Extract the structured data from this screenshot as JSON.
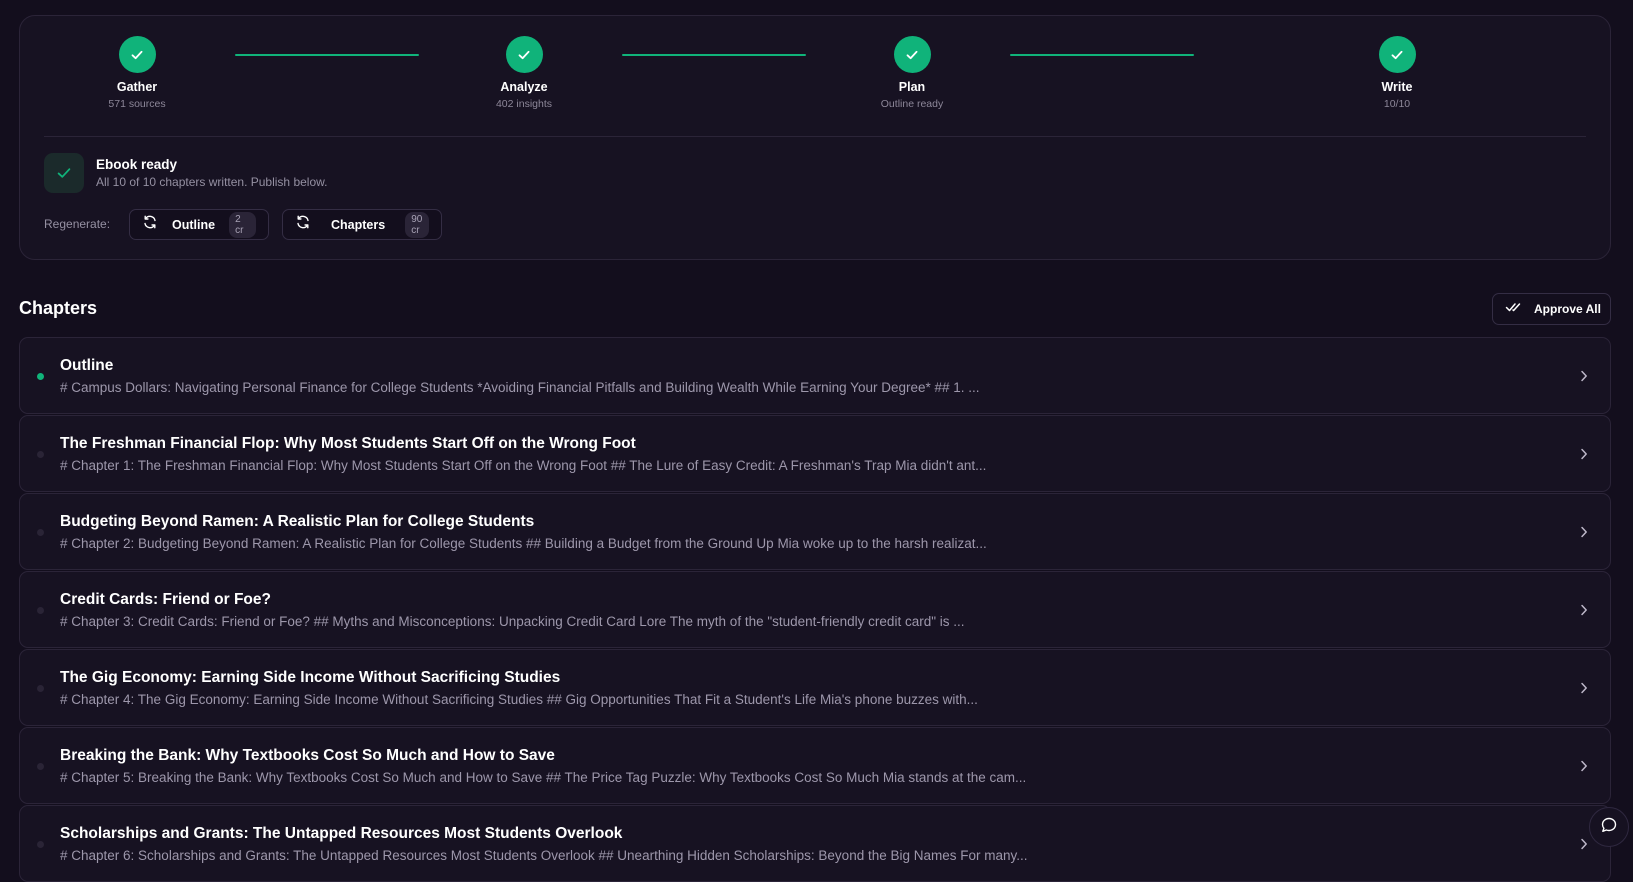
{
  "pipeline": {
    "steps": [
      {
        "label": "Gather",
        "sub": "571 sources"
      },
      {
        "label": "Analyze",
        "sub": "402 insights"
      },
      {
        "label": "Plan",
        "sub": "Outline ready"
      },
      {
        "label": "Write",
        "sub": "10/10"
      }
    ],
    "accent_color": "#10b37a"
  },
  "status": {
    "title": "Ebook ready",
    "subtitle": "All 10 of 10 chapters written. Publish below."
  },
  "regenerate": {
    "label": "Regenerate:",
    "outline": {
      "label": "Outline",
      "cost": "2 cr"
    },
    "chapters": {
      "label": "Chapters",
      "cost": "90 cr"
    }
  },
  "chapters": {
    "heading": "Chapters",
    "approve_all_label": "Approve All",
    "items": [
      {
        "title": "Outline",
        "preview": "# Campus Dollars: Navigating Personal Finance for College Students *Avoiding Financial Pitfalls and Building Wealth While Earning Your Degree* ## 1. ...",
        "active": true
      },
      {
        "title": "The Freshman Financial Flop: Why Most Students Start Off on the Wrong Foot",
        "preview": "# Chapter 1: The Freshman Financial Flop: Why Most Students Start Off on the Wrong Foot ## The Lure of Easy Credit: A Freshman's Trap Mia didn't ant...",
        "active": false
      },
      {
        "title": "Budgeting Beyond Ramen: A Realistic Plan for College Students",
        "preview": "# Chapter 2: Budgeting Beyond Ramen: A Realistic Plan for College Students ## Building a Budget from the Ground Up Mia woke up to the harsh realizat...",
        "active": false
      },
      {
        "title": "Credit Cards: Friend or Foe?",
        "preview": "# Chapter 3: Credit Cards: Friend or Foe? ## Myths and Misconceptions: Unpacking Credit Card Lore The myth of the \"student-friendly credit card\" is ...",
        "active": false
      },
      {
        "title": "The Gig Economy: Earning Side Income Without Sacrificing Studies",
        "preview": "# Chapter 4: The Gig Economy: Earning Side Income Without Sacrificing Studies ## Gig Opportunities That Fit a Student's Life Mia's phone buzzes with...",
        "active": false
      },
      {
        "title": "Breaking the Bank: Why Textbooks Cost So Much and How to Save",
        "preview": "# Chapter 5: Breaking the Bank: Why Textbooks Cost So Much and How to Save ## The Price Tag Puzzle: Why Textbooks Cost So Much Mia stands at the cam...",
        "active": false
      },
      {
        "title": "Scholarships and Grants: The Untapped Resources Most Students Overlook",
        "preview": "# Chapter 6: Scholarships and Grants: The Untapped Resources Most Students Overlook ## Unearthing Hidden Scholarships: Beyond the Big Names For many...",
        "active": false
      }
    ]
  },
  "icons": {
    "step": "check-icon",
    "status": "check-icon",
    "regenerate": "refresh-icon",
    "approve": "double-check-icon",
    "row": "chevron-right-icon",
    "chat": "chat-bubble-icon"
  }
}
